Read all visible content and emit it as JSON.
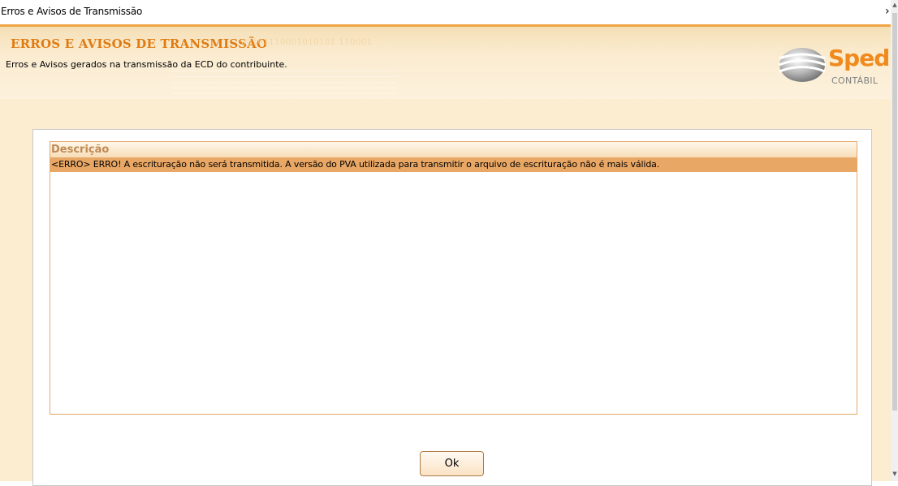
{
  "window": {
    "title": "Erros e Avisos de Transmissão"
  },
  "header": {
    "title": "ERROS E AVISOS DE TRANSMISSÃO",
    "decorative_binary": "00101110001010101 110001",
    "subtitle": "Erros e Avisos gerados na transmissão da ECD do contribuinte.",
    "logo_word": "Sped",
    "logo_sub": "CONTÁBIL",
    "accent_color": "#e07b12"
  },
  "grid": {
    "column_header": "Descrição",
    "rows": [
      "<ERRO> ERRO! A escrituração não será transmitida. A versão do PVA utilizada para transmitir o arquivo de escrituração não é mais válida."
    ],
    "selected_row_color": "#e8a765"
  },
  "buttons": {
    "ok_label": "Ok"
  }
}
